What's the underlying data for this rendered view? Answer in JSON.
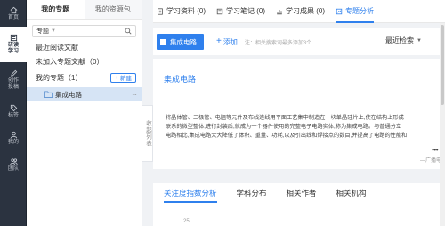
{
  "rail": {
    "items": [
      {
        "label": "首页",
        "icon": "home-icon"
      },
      {
        "label": "研读学习",
        "icon": "study-icon"
      },
      {
        "label": "创作投稿",
        "icon": "create-icon"
      },
      {
        "label": "标签",
        "icon": "tag-icon"
      },
      {
        "label": "我的",
        "icon": "user-icon"
      },
      {
        "label": "团队",
        "icon": "team-icon"
      }
    ]
  },
  "panel": {
    "tabs": [
      "我的专题",
      "我的资源包"
    ],
    "search": {
      "selected": "专题"
    },
    "recent": "最近阅读文献",
    "not_added": "未加入专题文献（0）",
    "my_topics": "我的专题（1）",
    "new_button": "新建",
    "topic": "集成电路",
    "collapse_label": "收起列表"
  },
  "main": {
    "tabs": [
      {
        "label": "学习资料 (0)"
      },
      {
        "label": "学习笔记 (0)"
      },
      {
        "label": "学习成果 (0)"
      },
      {
        "label": "专题分析"
      }
    ],
    "action": {
      "topic_button": "集成电路",
      "add": "添加",
      "note": "注：相关搜索词最多添加3个",
      "sort": "最近检索"
    },
    "card": {
      "title": "集成电路",
      "line1": "将晶体管、二极管、电阻等元件及布线连线用平面工艺集中制造在一块单晶硅片上,使在结构上形成",
      "line2": "联系的微型整体,进行封装后,就成为一个器件使用的完整电子电路实体,称为集成电路。与普通分立",
      "line3": "电路相比,集成电路大大降低了体积、重量、功耗,以及引出线和焊接点的数目,并提高了电路的性能和",
      "more": "•••",
      "source": "—广播电"
    },
    "bottom": {
      "tabs": [
        "关注度指数分析",
        "学科分布",
        "相关作者",
        "相关机构"
      ],
      "tick": "25"
    }
  },
  "colors": {
    "accent": "#2f80ed",
    "rail": "#2b3340",
    "topic_bg": "#d6e4f5"
  }
}
